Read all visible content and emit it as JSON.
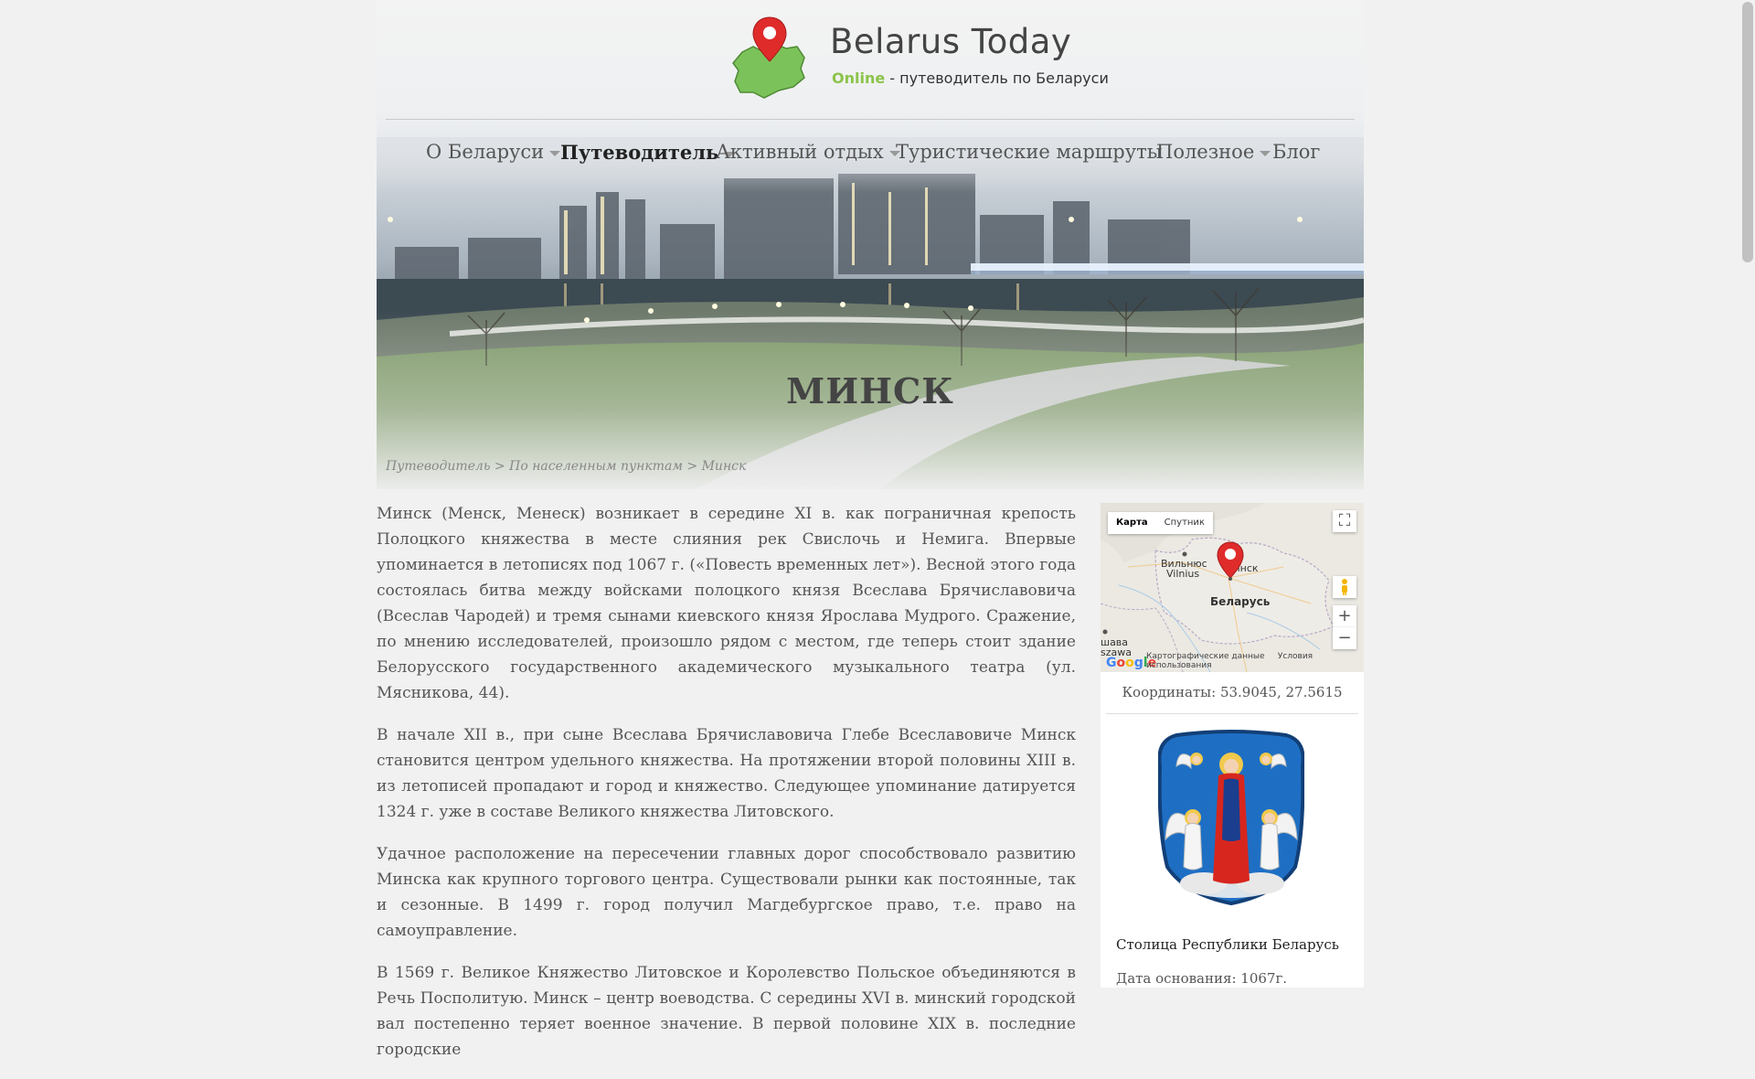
{
  "search": {
    "placeholder": ""
  },
  "site": {
    "title": "Belarus Today",
    "tagline_highlight": "Online",
    "tagline_rest": " - путеводитель по Беларуси"
  },
  "nav": [
    {
      "label": "О Беларуси",
      "dropdown": true,
      "active": false
    },
    {
      "label": "Путеводитель",
      "dropdown": true,
      "active": true
    },
    {
      "label": "Активный отдых",
      "dropdown": true,
      "active": false
    },
    {
      "label": "Туристические маршруты",
      "dropdown": false,
      "active": false
    },
    {
      "label": "Полезное",
      "dropdown": true,
      "active": false
    },
    {
      "label": "Блог",
      "dropdown": false,
      "active": false
    }
  ],
  "page": {
    "heading": "МИНСК",
    "breadcrumb": {
      "items": [
        "Путеводитель",
        "По населенным пунктам",
        "Минск"
      ],
      "separator": " > "
    }
  },
  "article": {
    "paragraphs": [
      "Минск (Менск, Менеск) возникает в середине XI в. как пограничная крепость Полоцкого княжества в месте слияния рек Свислочь и Немига. Впервые упоминается в летописях под 1067 г. («Повесть временных лет»). Весной этого года состоялась битва между войсками полоцкого князя Всеслава Брячиславовича (Всеслав Чародей) и тремя сынами киевского князя Ярослава Мудрого. Сражение, по мнению исследователей, произошло рядом с местом, где теперь стоит здание Белорусского государственного академического музыкального театра (ул. Мясникова, 44).",
      "В начале XII в., при сыне Всеслава Брячиславовича Глебе Всеславовиче Минск становится центром удельного княжества. На протяжении второй половины XIII в. из летописей пропадают и город и княжество. Следующее упоминание датируется 1324 г. уже в составе Великого княжества Литовского.",
      "Удачное расположение на пересечении главных дорог способствовало развитию Минска как крупного торгового центра. Существовали рынки как постоянные, так и сезонные. В 1499 г. город получил Магдебургское право, т.е. право на самоуправление.",
      "В 1569 г. Великое Княжество Литовское и Королевство Польское объединяются в Речь Посполитую. Минск – центр воеводства. С середины XVI в. минский городской вал постепенно теряет военное значение. В первой половине XIX в. последние городские"
    ]
  },
  "map": {
    "tab_map": "Карта",
    "tab_satellite": "Спутник",
    "labels": {
      "vilnius": "Вильнюс",
      "vilnius_latin": "Vilnius",
      "minsk": "Минск",
      "belarus": "Беларусь",
      "warsaw": "шава",
      "warsaw_latin": "szawa"
    },
    "zoom_in": "+",
    "zoom_out": "−",
    "google": "Google",
    "footer_data": "Картографические данные",
    "footer_terms": "Условия использования"
  },
  "info": {
    "coordinates": "Координаты: 53.9045, 27.5615",
    "caption": "Столица Республики Беларусь",
    "founded": "Дата основания: 1067г."
  }
}
